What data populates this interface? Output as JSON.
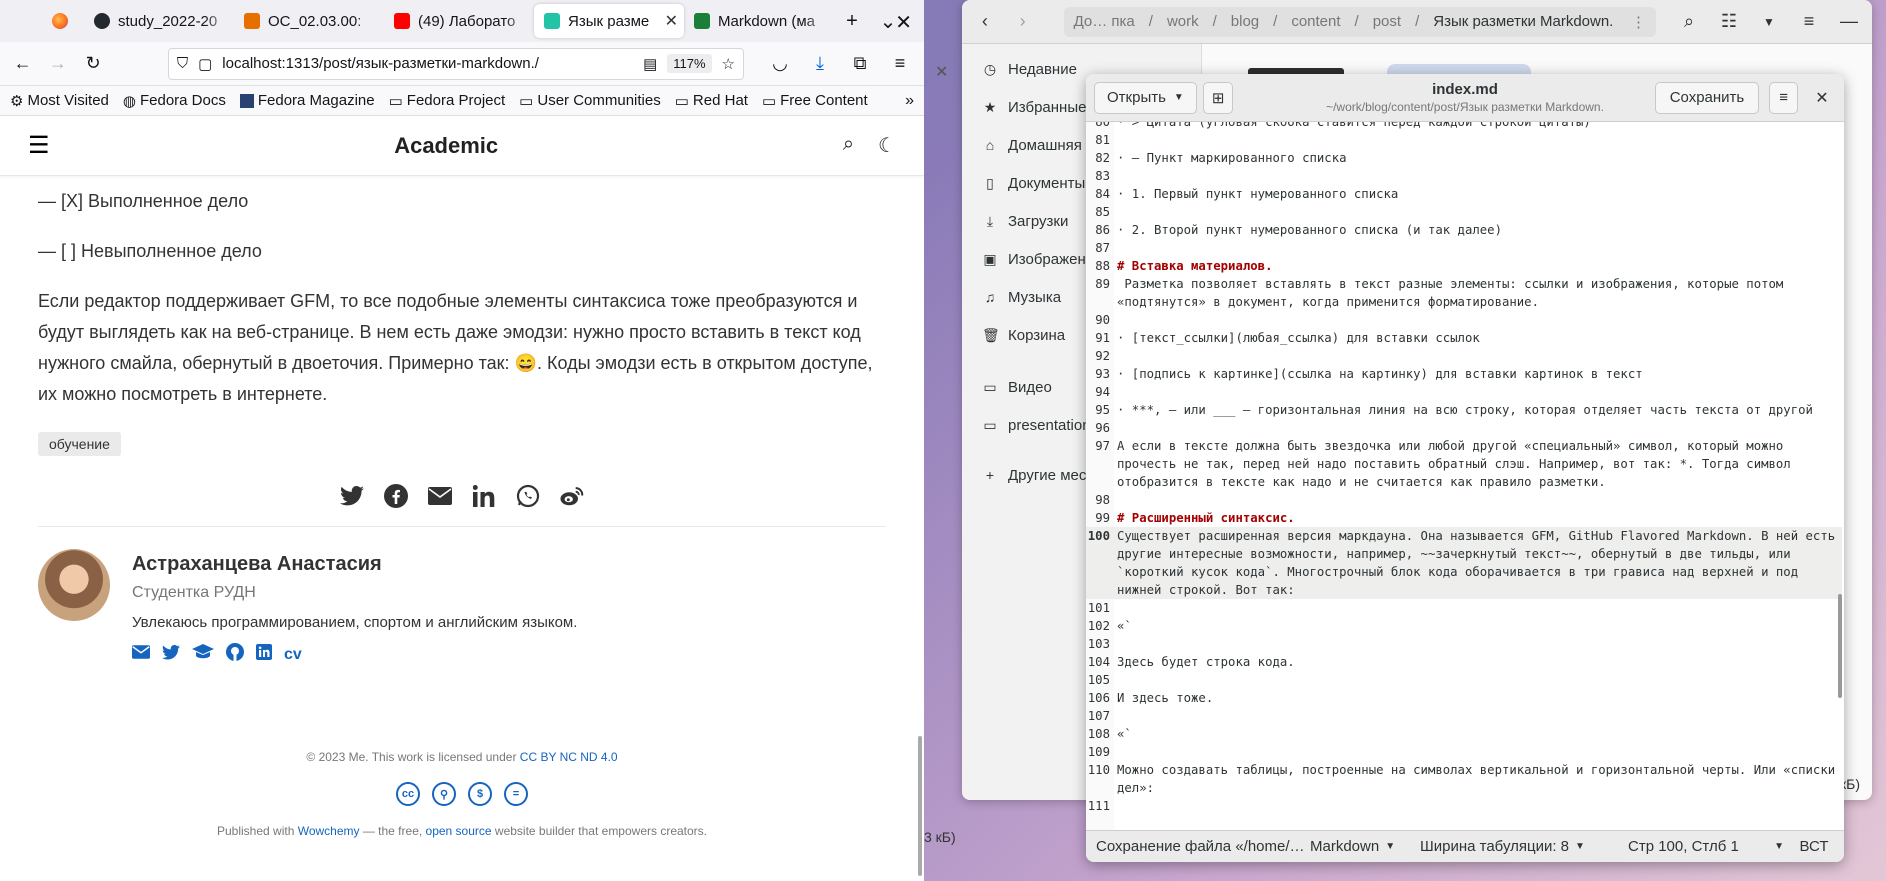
{
  "browser": {
    "tabs": [
      {
        "label": "study_2022-20",
        "favicon_color": "#24292f"
      },
      {
        "label": "ОС_02.03.00:",
        "favicon_color": "#e76f00"
      },
      {
        "label": "(49) Лаборато",
        "favicon_color": "#ff0000"
      },
      {
        "label": "Язык разме",
        "favicon_color": "#22c3a6"
      },
      {
        "label": "Markdown (ма",
        "favicon_color": "#1a7f37"
      }
    ],
    "url": "localhost:1313/post/язык-разметки-markdown./",
    "zoom": "117%",
    "bookmarks": [
      "Most Visited",
      "Fedora Docs",
      "Fedora Magazine",
      "Fedora Project",
      "User Communities",
      "Red Hat",
      "Free Content"
    ]
  },
  "site": {
    "title": "Academic",
    "task_done": "— [X] Выполненное дело",
    "task_todo": "— [ ] Невыполненное дело",
    "paragraph": "Если редактор поддерживает GFM, то все подобные элементы синтаксиса тоже преобразуются и будут выглядеть как на веб-странице. В нем есть даже эмодзи: нужно просто вставить в текст код нужного смайла, обернутый в двоеточия. Примерно так: 😄. Коды эмодзи есть в открытом доступе, их можно посмотреть в интернете.",
    "tag": "обучение",
    "author_name": "Астраханцева Анастасия",
    "author_role": "Студентка РУДН",
    "author_bio": "Увлекаюсь программированием, спортом и английским языком.",
    "cv_label": "cv",
    "license_prefix": "© 2023 Me. This work is licensed under ",
    "license_link": "CC BY NC ND 4.0",
    "pub_prefix": "Published with ",
    "pub_link1": "Wowchemy",
    "pub_mid": " — the free, ",
    "pub_link2": "open source",
    "pub_suffix": " website builder that empowers creators.",
    "accent": "#1565c0"
  },
  "files": {
    "breadcrumbs": [
      "До… пка",
      "work",
      "blog",
      "content",
      "post",
      "Язык разметки Markdown."
    ],
    "sidebar": [
      "Недавние",
      "Избранные",
      "Домашняя п",
      "Документы",
      "Загрузки",
      "Изображени",
      "Музыка",
      "Корзина",
      "Видео",
      "presentation",
      "Другие мест"
    ],
    "size_label": "6 кБ)",
    "left_size_label": "3 кБ)"
  },
  "editor": {
    "open_label": "Открыть",
    "save_label": "Сохранить",
    "file_name": "index.md",
    "file_path": "~/work/blog/content/post/Язык разметки Markdown.",
    "lines": [
      {
        "n": "80",
        "t": "· > Цитата (угловая скобка ставится перед каждой строкой цитаты)"
      },
      {
        "n": "81",
        "t": ""
      },
      {
        "n": "82",
        "t": "· — Пункт маркированного списка"
      },
      {
        "n": "83",
        "t": ""
      },
      {
        "n": "84",
        "t": "· 1. Первый пункт нумерованного списка"
      },
      {
        "n": "85",
        "t": ""
      },
      {
        "n": "86",
        "t": "· 2. Второй пункт нумерованного списка (и так далее)"
      },
      {
        "n": "87",
        "t": ""
      },
      {
        "n": "88",
        "t": "# Вставка материалов.",
        "head": true
      },
      {
        "n": "89",
        "t": " Разметка позволяет вставлять в текст разные элементы: ссылки и изображения, которые потом «подтянутся» в документ, когда применится форматирование."
      },
      {
        "n": "90",
        "t": ""
      },
      {
        "n": "91",
        "t": "· [текст_ссылки](любая_ссылка) для вставки ссылок"
      },
      {
        "n": "92",
        "t": ""
      },
      {
        "n": "93",
        "t": "· [подпись к картинке](ссылка на картинку) для вставки картинок в текст"
      },
      {
        "n": "94",
        "t": ""
      },
      {
        "n": "95",
        "t": "· ***, — или ___ — горизонтальная линия на всю строку, которая отделяет часть текста от другой"
      },
      {
        "n": "96",
        "t": ""
      },
      {
        "n": "97",
        "t": "А если в тексте должна быть звездочка или любой другой «специальный» символ, который можно прочесть не так, перед ней надо поставить обратный слэш. Например, вот так: *. Тогда символ отобразится в тексте как надо и не считается как правило разметки."
      },
      {
        "n": "98",
        "t": ""
      },
      {
        "n": "99",
        "t": "# Расширенный синтаксис.",
        "head": true
      },
      {
        "n": "100",
        "t": "Существует расширенная версия маркдауна. Она называется GFM, GitHub Flavored Markdown. В ней есть другие интересные возможности, например, ~~зачеркнутый текст~~, обернутый в две тильды, или `короткий кусок кода`. Многострочный блок кода оборачивается в три грависа над верхней и под нижней строкой. Вот так:",
        "cur": true
      },
      {
        "n": "101",
        "t": ""
      },
      {
        "n": "102",
        "t": "«`"
      },
      {
        "n": "103",
        "t": ""
      },
      {
        "n": "104",
        "t": "Здесь будет строка кода."
      },
      {
        "n": "105",
        "t": ""
      },
      {
        "n": "106",
        "t": "И здесь тоже."
      },
      {
        "n": "107",
        "t": ""
      },
      {
        "n": "108",
        "t": "«`"
      },
      {
        "n": "109",
        "t": ""
      },
      {
        "n": "110",
        "t": "Можно создавать таблицы, построенные на символах вертикальной и горизонтальной черты. Или «списки дел»:"
      },
      {
        "n": "111",
        "t": ""
      }
    ],
    "status": {
      "saving": "Сохранение файла «/home/…",
      "language": "Markdown",
      "tab_width": "Ширина табуляции: 8",
      "position": "Стр 100, Стлб 1",
      "mode": "ВСТ"
    }
  }
}
